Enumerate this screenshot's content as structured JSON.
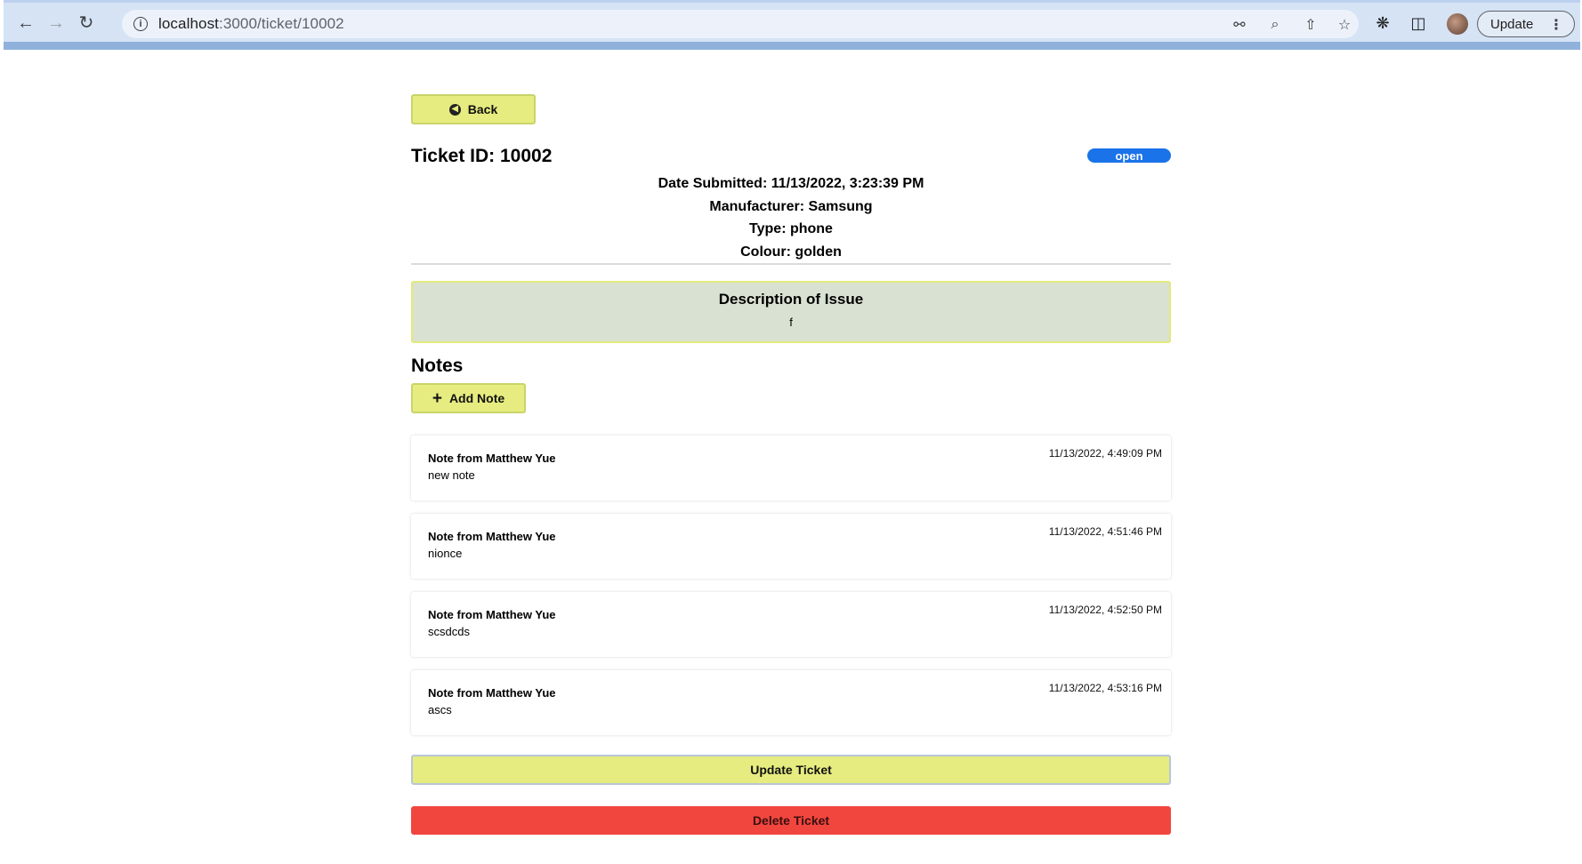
{
  "browser": {
    "url_host": "localhost",
    "url_path": ":3000/ticket/10002",
    "update_label": "Update"
  },
  "page": {
    "back_label": "Back",
    "ticket_title": "Ticket ID: 10002",
    "status": "open",
    "date_submitted": "Date Submitted: 11/13/2022, 3:23:39 PM",
    "manufacturer": "Manufacturer: Samsung",
    "type": "Type: phone",
    "colour": "Colour: golden",
    "description_heading": "Description of Issue",
    "description_text": "f",
    "notes_heading": "Notes",
    "add_note_label": "Add Note",
    "notes": [
      {
        "author": "Note from Matthew Yue",
        "text": "new note",
        "timestamp": "11/13/2022, 4:49:09 PM"
      },
      {
        "author": "Note from Matthew Yue",
        "text": "nionce",
        "timestamp": "11/13/2022, 4:51:46 PM"
      },
      {
        "author": "Note from Matthew Yue",
        "text": "scsdcds",
        "timestamp": "11/13/2022, 4:52:50 PM"
      },
      {
        "author": "Note from Matthew Yue",
        "text": "ascs",
        "timestamp": "11/13/2022, 4:53:16 PM"
      }
    ],
    "update_label": "Update Ticket",
    "delete_label": "Delete Ticket"
  },
  "colors": {
    "accent_yellow": "#e6ec7f",
    "status_blue": "#1a73e8",
    "delete_red": "#f1463e",
    "description_bg": "#d9e2d2"
  },
  "icons": [
    "back-arrow-icon",
    "forward-arrow-icon",
    "reload-icon",
    "site-info-icon",
    "key-icon",
    "zoom-icon",
    "share-icon",
    "bookmark-star-icon",
    "extensions-icon",
    "side-panel-icon",
    "kebab-menu-icon",
    "circle-back-icon",
    "plus-icon"
  ]
}
